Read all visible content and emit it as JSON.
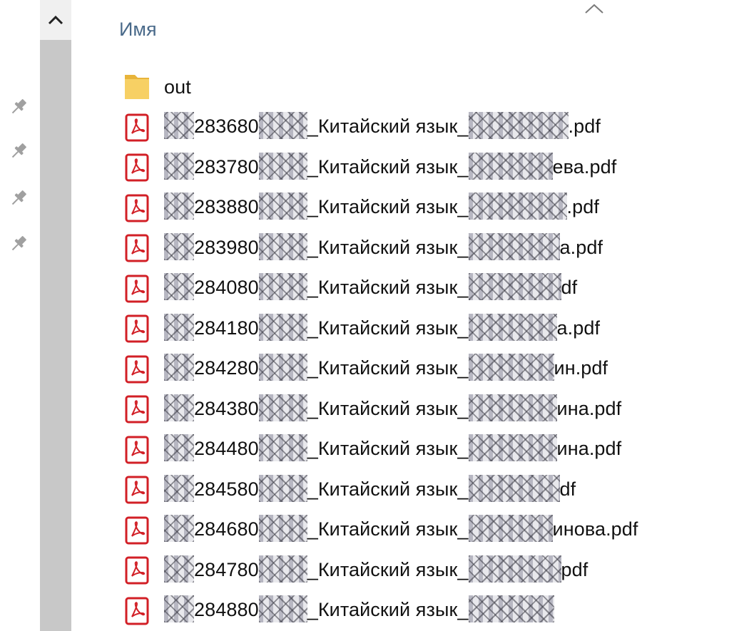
{
  "header": {
    "name_column": "Имя"
  },
  "icons": {
    "scroll_up": "chevron-up-icon",
    "sort": "sort-ascending-icon",
    "pin": "pin-icon",
    "folder": "folder-icon",
    "pdf": "pdf-icon"
  },
  "colors": {
    "header_text": "#4a6a8a",
    "pdf_red": "#d21f26",
    "folder_yellow": "#f5c94c",
    "scrollbar": "#c8c8c8"
  },
  "files": [
    {
      "type": "folder",
      "name": "out"
    },
    {
      "type": "pdf",
      "parts": [
        "283680",
        "_Китайский язык_",
        ".pdf"
      ]
    },
    {
      "type": "pdf",
      "parts": [
        "283780",
        "_Китайский язык_",
        "ева.pdf"
      ]
    },
    {
      "type": "pdf",
      "parts": [
        "283880",
        "_Китайский язык_",
        ".pdf"
      ]
    },
    {
      "type": "pdf",
      "parts": [
        "283980",
        "_Китайский язык_",
        "a.pdf"
      ]
    },
    {
      "type": "pdf",
      "parts": [
        "284080",
        "_Китайский язык_",
        "df"
      ]
    },
    {
      "type": "pdf",
      "parts": [
        "284180",
        "_Китайский язык_",
        "a.pdf"
      ]
    },
    {
      "type": "pdf",
      "parts": [
        "284280",
        "_Китайский язык_",
        "ин.pdf"
      ]
    },
    {
      "type": "pdf",
      "parts": [
        "284380",
        "_Китайский язык_",
        "ина.pdf"
      ]
    },
    {
      "type": "pdf",
      "parts": [
        "284480",
        "_Китайский язык_",
        "ина.pdf"
      ]
    },
    {
      "type": "pdf",
      "parts": [
        "284580",
        "_Китайский язык_",
        "df"
      ]
    },
    {
      "type": "pdf",
      "parts": [
        "284680",
        "_Китайский язык_",
        "инова.pdf"
      ]
    },
    {
      "type": "pdf",
      "parts": [
        "284780",
        "_Китайский язык_",
        "pdf"
      ]
    },
    {
      "type": "pdf",
      "parts": [
        "284880",
        "_Китайский язык_",
        ""
      ]
    }
  ]
}
